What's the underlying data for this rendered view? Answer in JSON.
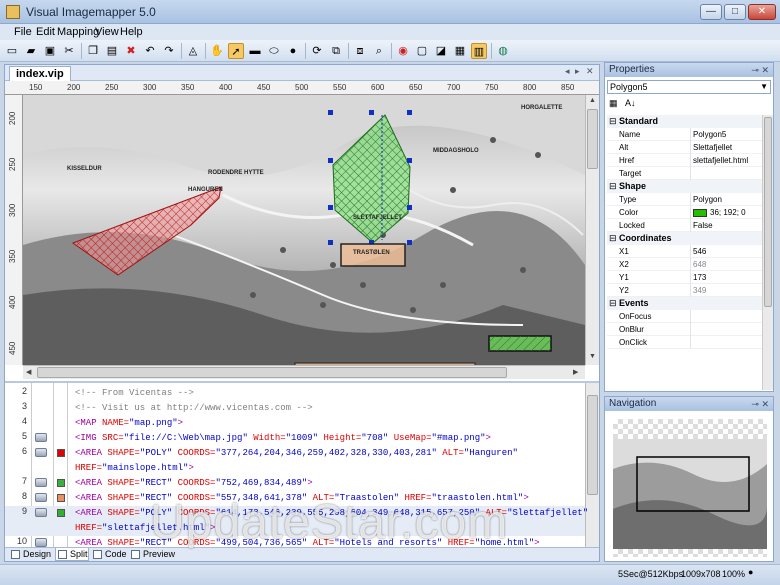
{
  "window": {
    "title": "Visual Imagemapper 5.0",
    "minimize": "—",
    "maximize": "□",
    "close": "✕"
  },
  "menu": [
    "File",
    "Edit",
    "Mapping",
    "View",
    "Help"
  ],
  "toolbar": {
    "icons": [
      "new-icon",
      "open-icon",
      "save-icon",
      "cut-icon",
      "copy-icon",
      "paste-icon",
      "delete-icon",
      "undo-icon",
      "redo-icon",
      "lock-icon",
      "hand-icon",
      "pointer-icon",
      "rect-icon",
      "ellipse-icon",
      "circle-icon",
      "rotate-icon",
      "copy-shape-icon",
      "paste-shape-icon",
      "zoom-icon",
      "target-icon",
      "image-icon",
      "fill-icon",
      "grid-icon",
      "highlight-icon",
      "globe-icon"
    ],
    "active": [
      "pointer-icon",
      "highlight-icon"
    ]
  },
  "document": {
    "tab": "index.vip",
    "nav_prev": "◂",
    "nav_next": "▸",
    "nav_close": "✕"
  },
  "ruler": {
    "h": [
      "150",
      "200",
      "250",
      "300",
      "350",
      "400",
      "450",
      "500",
      "550",
      "600",
      "650",
      "700",
      "750",
      "800",
      "850"
    ],
    "v": [
      "200",
      "250",
      "300",
      "350",
      "400",
      "450"
    ]
  },
  "map": {
    "labels": [
      "HORGALETTE",
      "MIDDAGSHOLO",
      "KISSELDUR",
      "RODENDRE HYTTE",
      "HANGUREN",
      "SLETTAFJELLET",
      "TRASTØLEN"
    ]
  },
  "code": {
    "lines": [
      {
        "num": "2",
        "parts": [
          [
            "com",
            "<!-- From Vicentas -->"
          ]
        ]
      },
      {
        "num": "3",
        "parts": [
          [
            "com",
            "<!-- Visit us at http://www.vicentas.com -->"
          ]
        ]
      },
      {
        "num": "4",
        "parts": [
          [
            "tag",
            "<MAP "
          ],
          [
            "attr",
            "NAME="
          ],
          [
            "val",
            "\"map.png\""
          ],
          [
            "tag",
            ">"
          ]
        ]
      },
      {
        "num": "5",
        "parts": [
          [
            "tag",
            "<IMG "
          ],
          [
            "attr",
            "SRC="
          ],
          [
            "val",
            "\"file://C:\\Web\\map.jpg\" "
          ],
          [
            "attr",
            "Width="
          ],
          [
            "val",
            "\"1009\" "
          ],
          [
            "attr",
            "Height="
          ],
          [
            "val",
            "\"708\" "
          ],
          [
            "attr",
            "UseMap="
          ],
          [
            "val",
            "\"#map.png\""
          ],
          [
            "tag",
            ">"
          ]
        ]
      },
      {
        "num": "6",
        "parts": [
          [
            "tag",
            "<AREA "
          ],
          [
            "attr",
            "SHAPE="
          ],
          [
            "val",
            "\"POLY\" "
          ],
          [
            "attr",
            "COORDS="
          ],
          [
            "val",
            "\"377,264,204,346,259,402,328,330,403,281\" "
          ],
          [
            "attr",
            "ALT="
          ],
          [
            "val",
            "\"Hanguren\""
          ]
        ]
      },
      {
        "num": "",
        "parts": [
          [
            "attr",
            "HREF="
          ],
          [
            "val",
            "\"mainslope.html\""
          ],
          [
            "tag",
            ">"
          ]
        ]
      },
      {
        "num": "7",
        "parts": [
          [
            "tag",
            "<AREA "
          ],
          [
            "attr",
            "SHAPE="
          ],
          [
            "val",
            "\"RECT\" "
          ],
          [
            "attr",
            "COORDS="
          ],
          [
            "val",
            "\"752,469,834,489\""
          ],
          [
            "tag",
            ">"
          ]
        ]
      },
      {
        "num": "8",
        "parts": [
          [
            "tag",
            "<AREA "
          ],
          [
            "attr",
            "SHAPE="
          ],
          [
            "val",
            "\"RECT\" "
          ],
          [
            "attr",
            "COORDS="
          ],
          [
            "val",
            "\"557,348,641,378\" "
          ],
          [
            "attr",
            "ALT="
          ],
          [
            "val",
            "\"Traastolen\" "
          ],
          [
            "attr",
            "HREF="
          ],
          [
            "val",
            "\"traastolen.html\""
          ],
          [
            "tag",
            ">"
          ]
        ]
      },
      {
        "num": "9",
        "parts": [
          [
            "tag",
            "<AREA "
          ],
          [
            "attr",
            "SHAPE="
          ],
          [
            "val",
            "\"POLY\" "
          ],
          [
            "attr",
            "COORDS="
          ],
          [
            "val",
            "\"614,173,546,239,555,298,604,349,648,315,657,250\" "
          ],
          [
            "attr",
            "ALT="
          ],
          [
            "val",
            "\"Slettafjellet\""
          ]
        ]
      },
      {
        "num": "",
        "parts": [
          [
            "attr",
            "HREF="
          ],
          [
            "val",
            "\"slettafjellet.html\""
          ],
          [
            "tag",
            ">"
          ]
        ]
      },
      {
        "num": "10",
        "parts": [
          [
            "tag",
            "<AREA "
          ],
          [
            "attr",
            "SHAPE="
          ],
          [
            "val",
            "\"RECT\" "
          ],
          [
            "attr",
            "COORDS="
          ],
          [
            "val",
            "\"499,504,736,565\" "
          ],
          [
            "attr",
            "ALT="
          ],
          [
            "val",
            "\"Hotels and resorts\" "
          ],
          [
            "attr",
            "HREF="
          ],
          [
            "val",
            "\"home.html\""
          ],
          [
            "tag",
            ">"
          ]
        ]
      }
    ],
    "swatches": {
      "6": "#e00000",
      "7": "#3cb03c",
      "8": "#e89060",
      "9": "#30b030"
    }
  },
  "view_tabs": [
    "Design",
    "Split",
    "Code",
    "Preview"
  ],
  "properties": {
    "title": "Properties",
    "selected": "Polygon5",
    "categories": [
      {
        "name": "Standard",
        "rows": [
          [
            "Name",
            "Polygon5"
          ],
          [
            "Alt",
            "Slettafjellet"
          ],
          [
            "Href",
            "slettafjellet.html"
          ],
          [
            "Target",
            ""
          ]
        ]
      },
      {
        "name": "Shape",
        "rows": [
          [
            "Type",
            "Polygon"
          ],
          [
            "Color",
            "36; 192; 0"
          ],
          [
            "Locked",
            "False"
          ]
        ]
      },
      {
        "name": "Coordinates",
        "rows": [
          [
            "X1",
            "546"
          ],
          [
            "X2",
            "648"
          ],
          [
            "Y1",
            "173"
          ],
          [
            "Y2",
            "349"
          ]
        ]
      },
      {
        "name": "Events",
        "rows": [
          [
            "OnFocus",
            ""
          ],
          [
            "OnBlur",
            ""
          ],
          [
            "OnClick",
            ""
          ]
        ]
      }
    ],
    "color_value": "#24c000"
  },
  "navigation": {
    "title": "Navigation"
  },
  "status": {
    "speed": "5Sec@512Kbps",
    "size": "1009x708",
    "zoom": "100%"
  },
  "watermark": "UpdateStar.com"
}
